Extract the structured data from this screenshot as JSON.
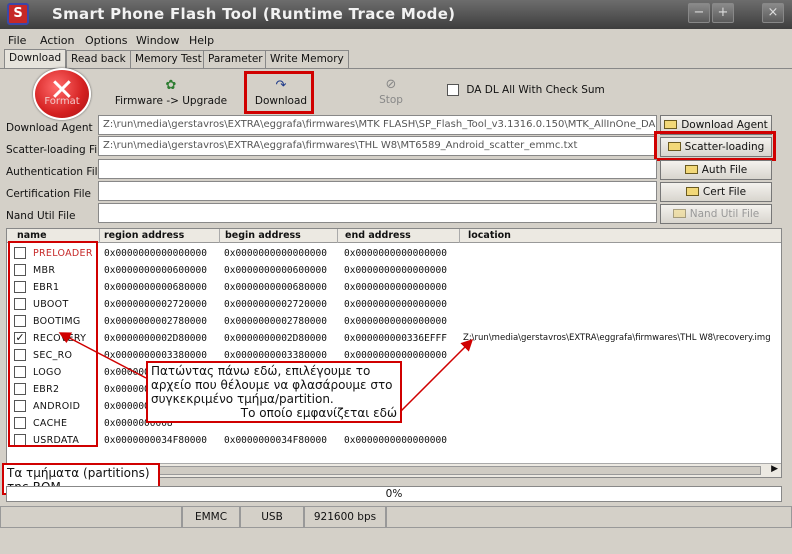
{
  "window": {
    "title": "Smart Phone Flash Tool (Runtime Trace Mode)",
    "controls": [
      "−",
      "+",
      "×"
    ]
  },
  "menu": [
    "File",
    "Action",
    "Options",
    "Window",
    "Help"
  ],
  "tabs": [
    {
      "label": "Download",
      "active": true
    },
    {
      "label": "Read back",
      "active": false
    },
    {
      "label": "Memory Test",
      "active": false
    },
    {
      "label": "Parameter",
      "active": false
    },
    {
      "label": "Write Memory",
      "active": false
    }
  ],
  "toolbar": {
    "format_label": "Format",
    "firmware_upgrade_label": "Firmware -> Upgrade",
    "download_label": "Download",
    "stop_label": "Stop",
    "checksum_label": "DA DL All With Check Sum",
    "checksum_checked": false
  },
  "fields": [
    {
      "label": "Download Agent",
      "value": "Z:\\run\\media\\gerstavros\\EXTRA\\eggrafa\\firmwares\\MTK FLASH\\SP_Flash_Tool_v3.1316.0.150\\MTK_AllInOne_DA.bin",
      "button": "Download Agent",
      "enabled": true
    },
    {
      "label": "Scatter-loading File",
      "value": "Z:\\run\\media\\gerstavros\\EXTRA\\eggrafa\\firmwares\\THL W8\\MT6589_Android_scatter_emmc.txt",
      "button": "Scatter-loading",
      "enabled": true
    },
    {
      "label": "Authentication File",
      "value": "",
      "button": "Auth File",
      "enabled": true
    },
    {
      "label": "Certification File",
      "value": "",
      "button": "Cert File",
      "enabled": true
    },
    {
      "label": "Nand Util File",
      "value": "",
      "button": "Nand Util File",
      "enabled": false
    }
  ],
  "table": {
    "columns": [
      "name",
      "region address",
      "begin address",
      "end address",
      "location"
    ],
    "rows": [
      {
        "checked": false,
        "name": "PRELOADER",
        "red": true,
        "region": "0x0000000000000000",
        "begin": "0x0000000000000000",
        "end": "0x0000000000000000",
        "location": ""
      },
      {
        "checked": false,
        "name": "MBR",
        "red": false,
        "region": "0x0000000000600000",
        "begin": "0x0000000000600000",
        "end": "0x0000000000000000",
        "location": ""
      },
      {
        "checked": false,
        "name": "EBR1",
        "red": false,
        "region": "0x0000000000680000",
        "begin": "0x0000000000680000",
        "end": "0x0000000000000000",
        "location": ""
      },
      {
        "checked": false,
        "name": "UBOOT",
        "red": false,
        "region": "0x0000000002720000",
        "begin": "0x0000000002720000",
        "end": "0x0000000000000000",
        "location": ""
      },
      {
        "checked": false,
        "name": "BOOTIMG",
        "red": false,
        "region": "0x0000000002780000",
        "begin": "0x0000000002780000",
        "end": "0x0000000000000000",
        "location": ""
      },
      {
        "checked": true,
        "name": "RECOVERY",
        "red": false,
        "region": "0x0000000002D80000",
        "begin": "0x0000000002D80000",
        "end": "0x000000000336EFFF",
        "location": "Z:\\run\\media\\gerstavros\\EXTRA\\eggrafa\\firmwares\\THL W8\\recovery.img"
      },
      {
        "checked": false,
        "name": "SEC_RO",
        "red": false,
        "region": "0x0000000003380000",
        "begin": "0x0000000003380000",
        "end": "0x0000000000000000",
        "location": ""
      },
      {
        "checked": false,
        "name": "LOGO",
        "red": false,
        "region": "0x0000000003",
        "begin": "",
        "end": "",
        "location": ""
      },
      {
        "checked": false,
        "name": "EBR2",
        "red": false,
        "region": "0x0000000003",
        "begin": "",
        "end": "",
        "location": ""
      },
      {
        "checked": false,
        "name": "ANDROID",
        "red": false,
        "region": "0x0000000004",
        "begin": "",
        "end": "",
        "location": ""
      },
      {
        "checked": false,
        "name": "CACHE",
        "red": false,
        "region": "0x0000000008",
        "begin": "",
        "end": "",
        "location": ""
      },
      {
        "checked": false,
        "name": "USRDATA",
        "red": false,
        "region": "0x0000000034F80000",
        "begin": "0x0000000034F80000",
        "end": "0x0000000000000000",
        "location": ""
      }
    ]
  },
  "annotations": {
    "partition_note": "Πατώντας πάνω εδώ, επιλέγουμε το αρχείο που θέλουμε να φλασάρουμε στο συγκεκριμένο τμήμα/partition.",
    "partition_note_2": "Το οποίο εμφανίζεται εδώ",
    "rom_note": "Τα τμήματα (partitions) της ROM"
  },
  "progress": {
    "text": "0%",
    "value": 0
  },
  "status": {
    "storage": "EMMC",
    "port": "USB",
    "baud": "921600 bps"
  },
  "colors": {
    "highlight": "#d00000",
    "preloader_text": "#c62828"
  }
}
